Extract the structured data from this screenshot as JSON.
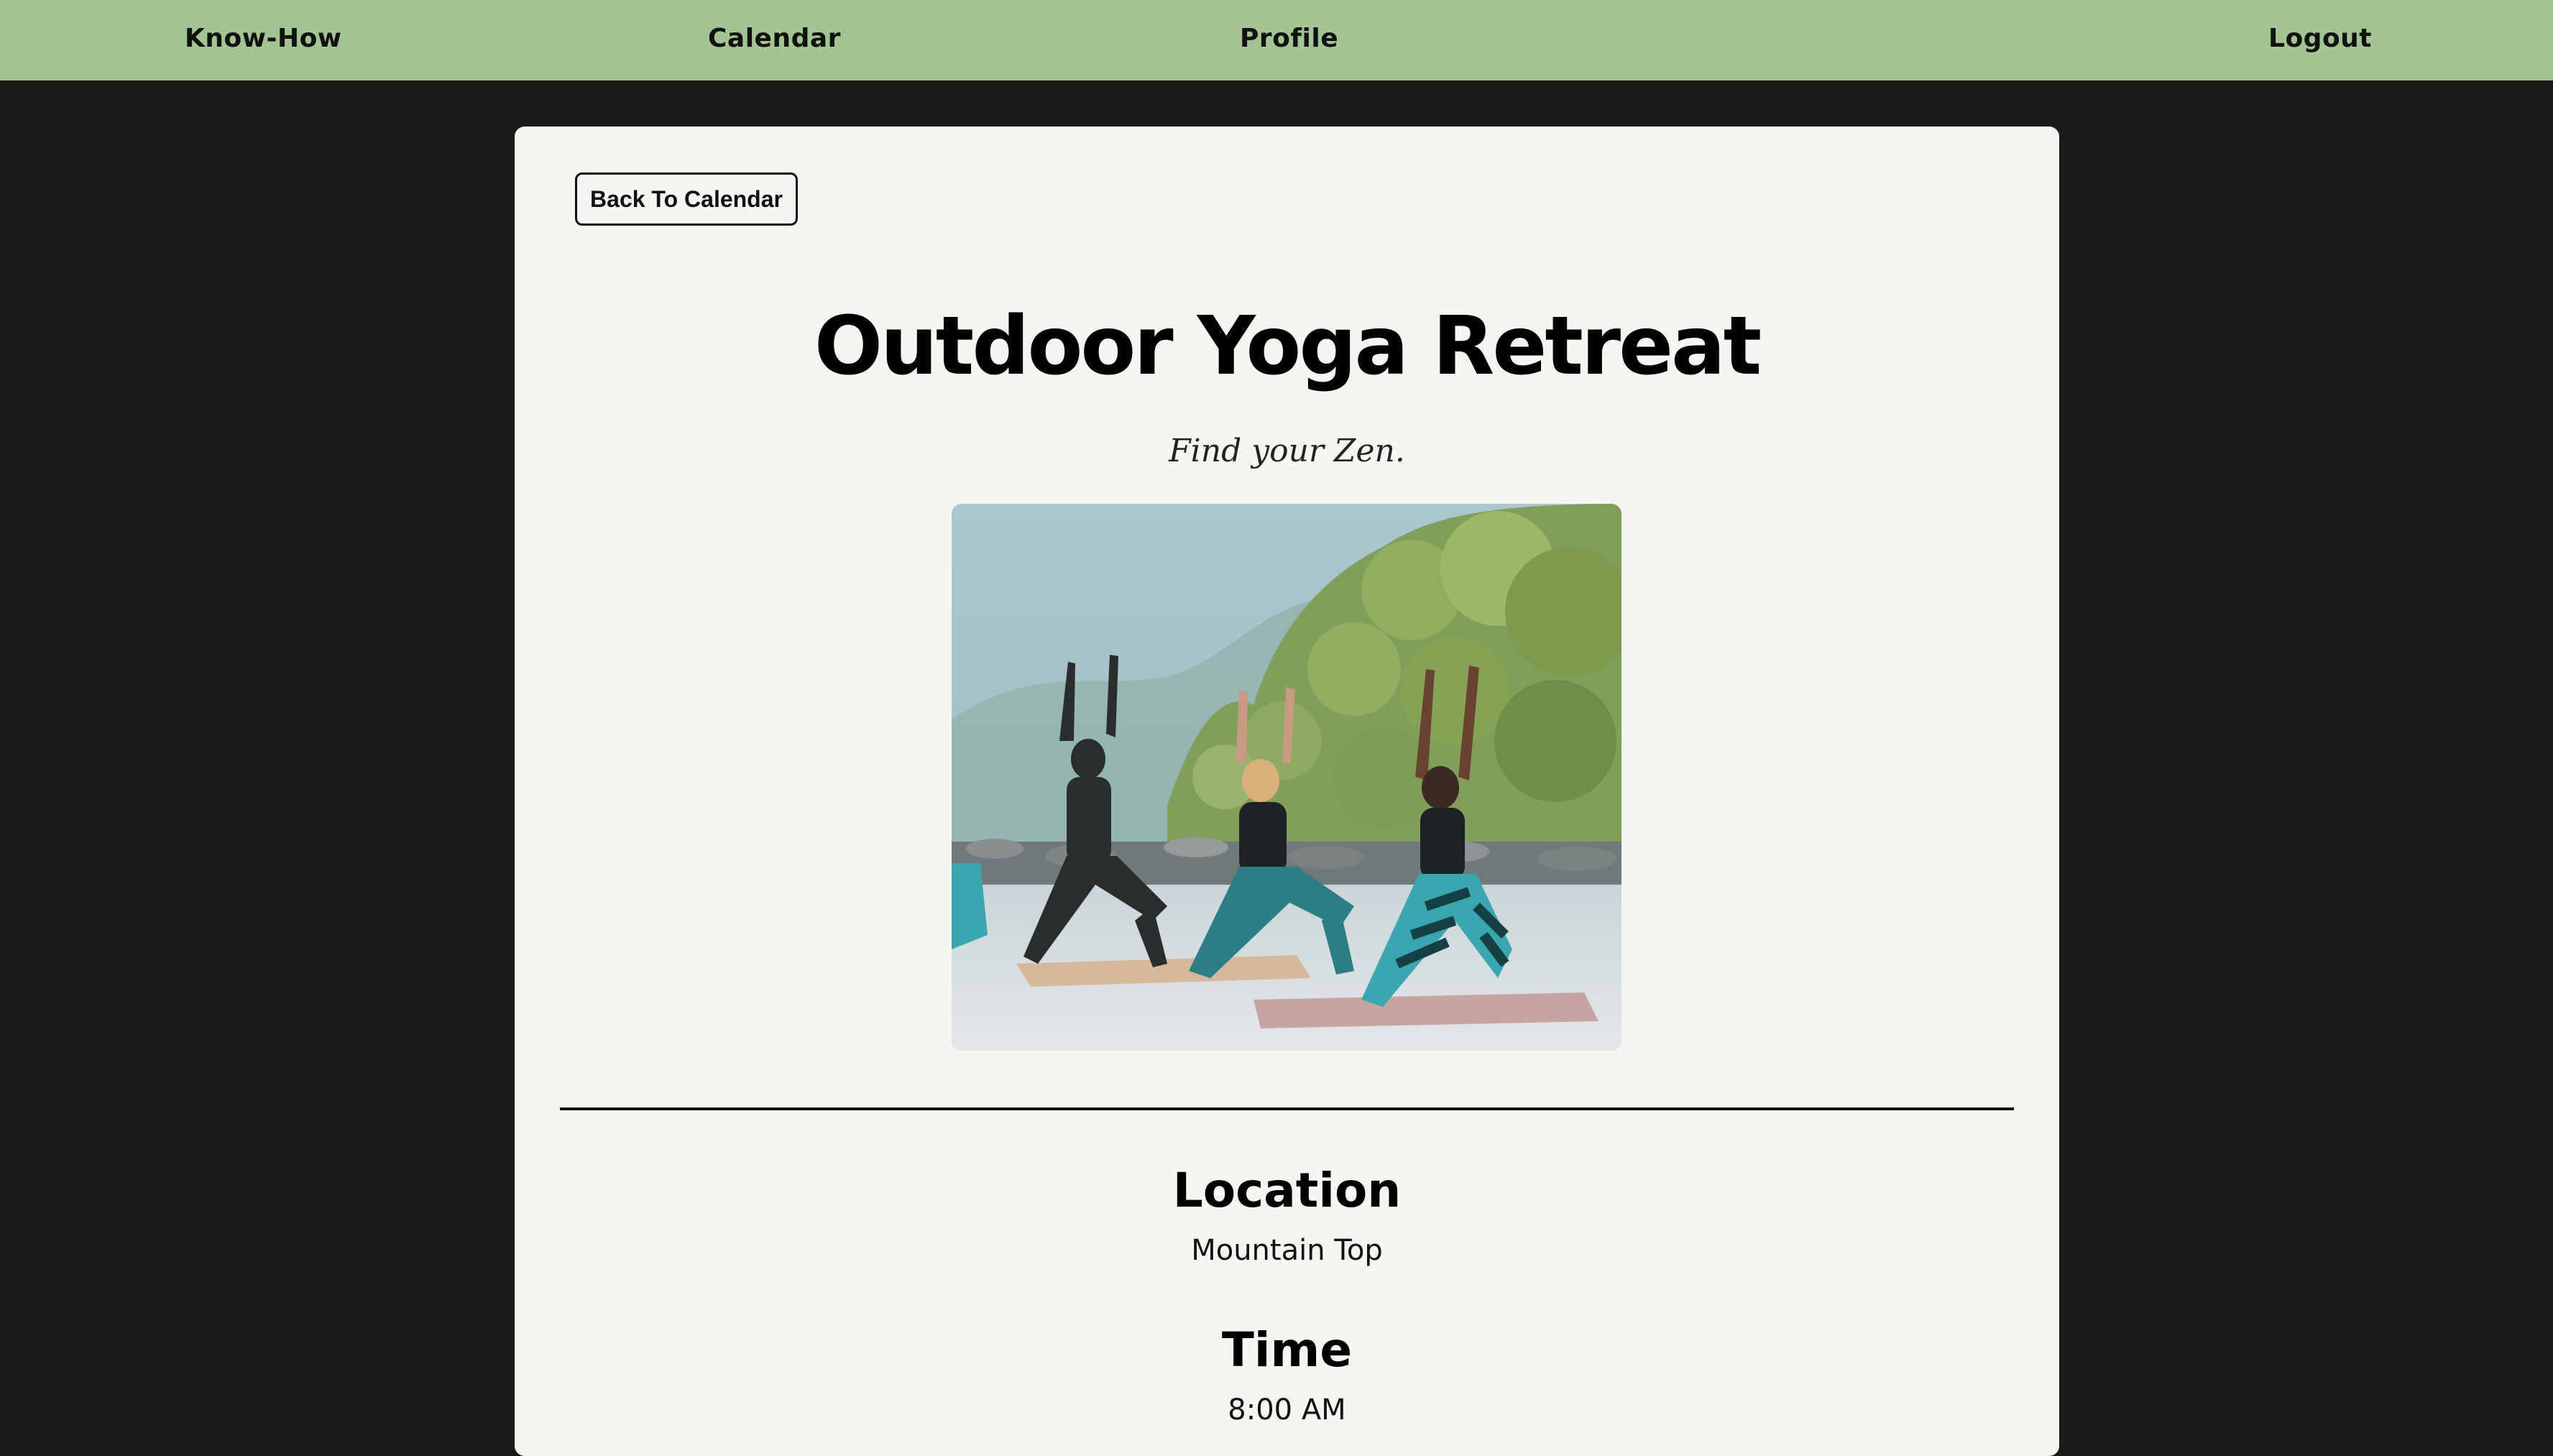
{
  "nav": {
    "knowhow": "Know-How",
    "calendar": "Calendar",
    "profile": "Profile",
    "logout": "Logout"
  },
  "event": {
    "back_button": "Back To Calendar",
    "title": "Outdoor Yoga Retreat",
    "subtitle": "Find your Zen.",
    "image_icon": "yoga-class-photo",
    "location_heading": "Location",
    "location_value": "Mountain Top",
    "time_heading": "Time",
    "time_value": "8:00 AM"
  },
  "colors": {
    "navbar": "#a2c592",
    "page_background": "#1a1a1c",
    "card_background": "#f6f5f1"
  }
}
